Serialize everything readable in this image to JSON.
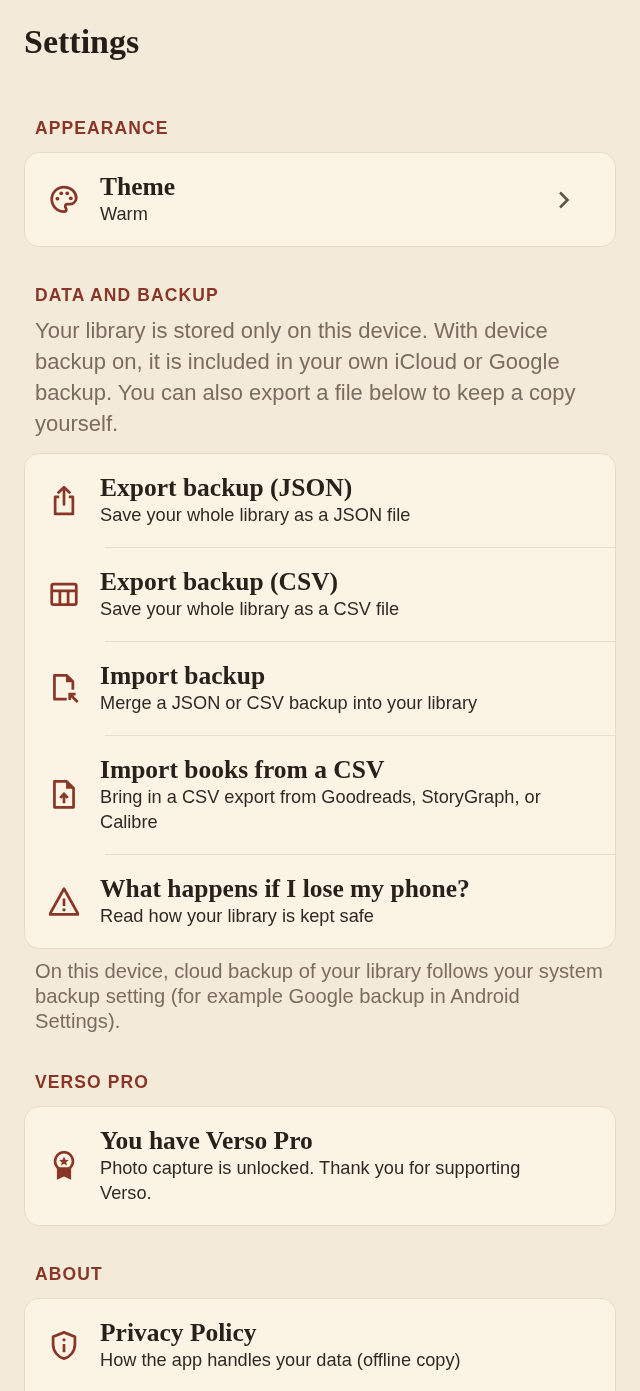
{
  "title": "Settings",
  "sections": [
    {
      "header": "APPEARANCE",
      "rows": [
        {
          "title": "Theme",
          "subtitle": "Warm",
          "chevron": true
        }
      ]
    },
    {
      "header": "DATA AND BACKUP",
      "intro": "Your library is stored only on this device. With device backup on, it is included in your own iCloud or Google backup. You can also export a file below to keep a copy yourself.",
      "rows": [
        {
          "title": "Export backup (JSON)",
          "subtitle": "Save your whole library as a JSON file",
          "chevron": false
        },
        {
          "title": "Export backup (CSV)",
          "subtitle": "Save your whole library as a CSV file",
          "chevron": false
        },
        {
          "title": "Import backup",
          "subtitle": "Merge a JSON or CSV backup into your library",
          "chevron": false
        },
        {
          "title": "Import books from a CSV",
          "subtitle": "Bring in a CSV export from Goodreads, StoryGraph, or Calibre",
          "chevron": false
        },
        {
          "title": "What happens if I lose my phone?",
          "subtitle": "Read how your library is kept safe",
          "chevron": false
        }
      ],
      "note": "On this device, cloud backup of your library follows your system backup setting (for example Google backup in Android Settings)."
    },
    {
      "header": "VERSO PRO",
      "rows": [
        {
          "title": "You have Verso Pro",
          "subtitle": "Photo capture is unlocked. Thank you for supporting Verso.",
          "chevron": false
        }
      ]
    },
    {
      "header": "ABOUT",
      "rows": [
        {
          "title": "Privacy Policy",
          "subtitle": "How the app handles your data (offline copy)",
          "chevron": false
        }
      ]
    }
  ]
}
